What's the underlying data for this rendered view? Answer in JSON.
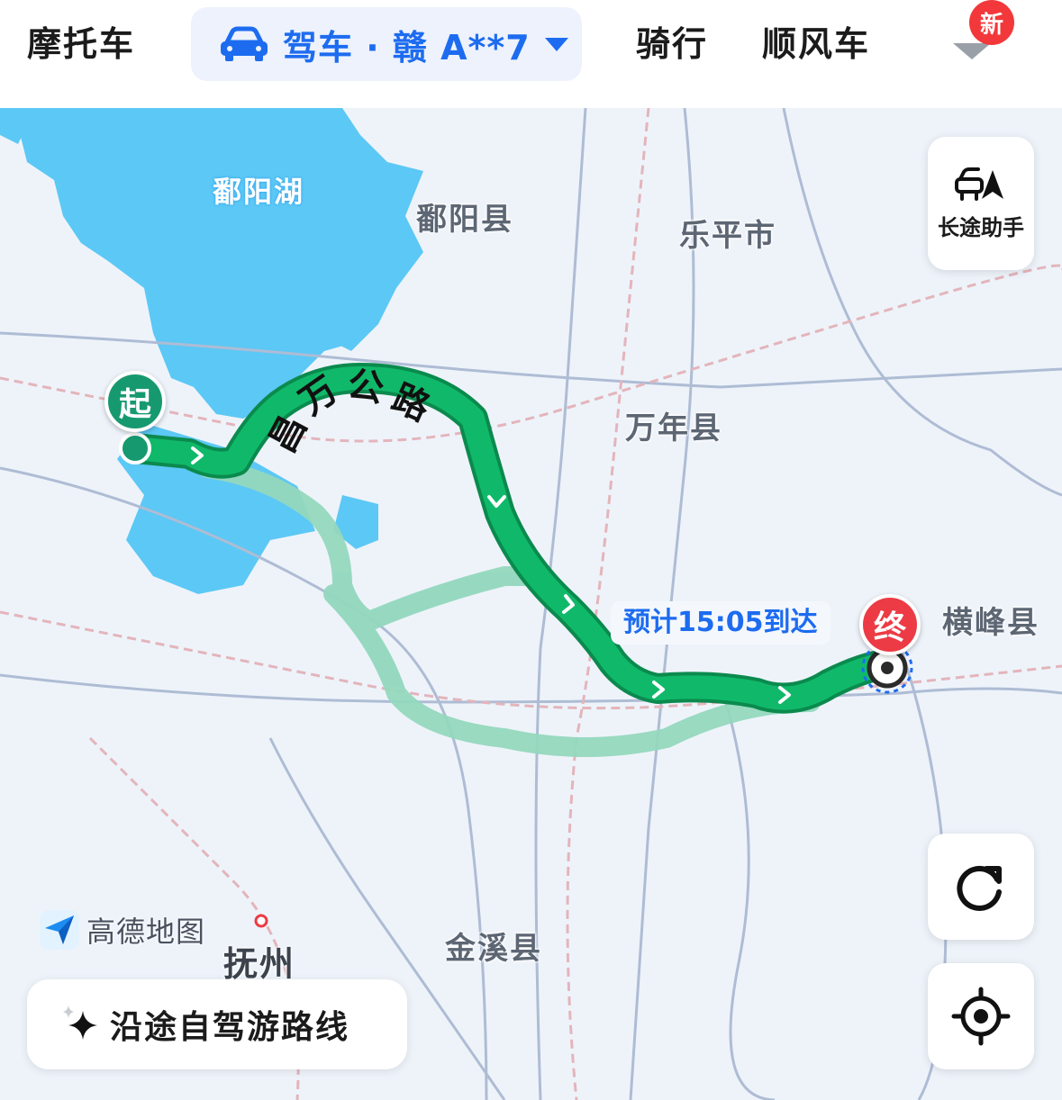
{
  "top_tabs": {
    "motorcycle": "摩托车",
    "drive_label": "驾车 · 赣 A**7",
    "cycling": "骑行",
    "carpool": "顺风车",
    "new_badge": "新"
  },
  "map": {
    "places": {
      "lake": "鄱阳湖",
      "poyang_county": "鄱阳县",
      "leping": "乐平市",
      "wannian": "万年县",
      "hengfeng": "横峰县",
      "jinxi": "金溪县",
      "fuzhou": "抚州"
    },
    "road_name_chars": [
      "昌",
      "万",
      "公",
      "路"
    ],
    "eta_label": "预计15:05到达",
    "start_marker": "起",
    "end_marker": "终",
    "logo_text": "高德地图"
  },
  "controls": {
    "long_trip_assistant": "长途助手",
    "tour_route_button": "沿途自驾游路线"
  },
  "colors": {
    "accent_blue": "#1d6cf0",
    "route_main": "#10b96a",
    "route_alt": "#93d8bd",
    "start_green": "#17996f",
    "end_red": "#ec3b44",
    "water": "#5cc8f5"
  }
}
